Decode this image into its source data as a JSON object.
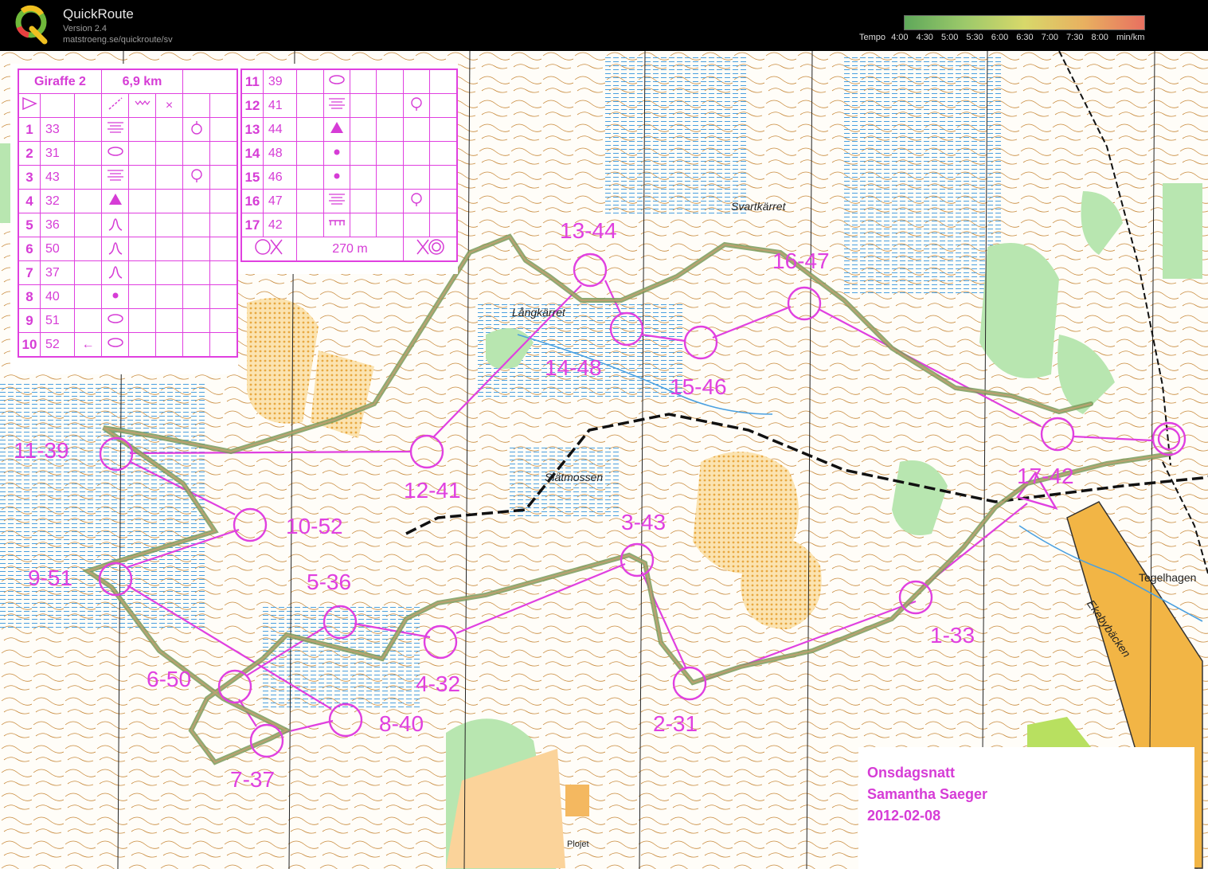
{
  "app": {
    "title": "QuickRoute",
    "version": "Version 2.4",
    "url": "matstroeng.se/quickroute/sv"
  },
  "tempo_legend": {
    "label": "Tempo",
    "ticks": [
      "4:00",
      "4:30",
      "5:00",
      "5:30",
      "6:00",
      "6:30",
      "7:00",
      "7:30",
      "8:00"
    ],
    "unit": "min/km",
    "colors": [
      "#5fa85a",
      "#9cc96a",
      "#d8d86a",
      "#e8b060",
      "#e87060"
    ]
  },
  "course": {
    "name": "Giraffe 2",
    "length": "6,9 km",
    "finish_distance": "270 m",
    "route_color": "#e040e0",
    "controls_left": [
      {
        "num": "1",
        "code": "33",
        "feature": "terrace",
        "extra": "ring"
      },
      {
        "num": "2",
        "code": "31",
        "feature": "depression",
        "extra": ""
      },
      {
        "num": "3",
        "code": "43",
        "feature": "terrace",
        "extra": "ring-lower"
      },
      {
        "num": "4",
        "code": "32",
        "feature": "triangle",
        "extra": ""
      },
      {
        "num": "5",
        "code": "36",
        "feature": "spur",
        "extra": ""
      },
      {
        "num": "6",
        "code": "50",
        "feature": "spur",
        "extra": ""
      },
      {
        "num": "7",
        "code": "37",
        "feature": "spur",
        "extra": ""
      },
      {
        "num": "8",
        "code": "40",
        "feature": "dot",
        "extra": ""
      },
      {
        "num": "9",
        "code": "51",
        "feature": "depression",
        "extra": ""
      },
      {
        "num": "10",
        "code": "52",
        "feature": "depression",
        "extra": "arrow"
      }
    ],
    "controls_right": [
      {
        "num": "11",
        "code": "39",
        "feature": "depression",
        "extra": ""
      },
      {
        "num": "12",
        "code": "41",
        "feature": "terrace",
        "extra": "ring-lower"
      },
      {
        "num": "13",
        "code": "44",
        "feature": "triangle",
        "extra": ""
      },
      {
        "num": "14",
        "code": "48",
        "feature": "dot",
        "extra": ""
      },
      {
        "num": "15",
        "code": "46",
        "feature": "dot",
        "extra": ""
      },
      {
        "num": "16",
        "code": "47",
        "feature": "terrace",
        "extra": "ring-lower"
      },
      {
        "num": "17",
        "code": "42",
        "feature": "wall",
        "extra": ""
      }
    ]
  },
  "map_labels": [
    {
      "id": "1-33",
      "text": "1-33"
    },
    {
      "id": "2-31",
      "text": "2-31"
    },
    {
      "id": "3-43",
      "text": "3-43"
    },
    {
      "id": "4-32",
      "text": "4-32"
    },
    {
      "id": "5-36",
      "text": "5-36"
    },
    {
      "id": "6-50",
      "text": "6-50"
    },
    {
      "id": "7-37",
      "text": "7-37"
    },
    {
      "id": "8-40",
      "text": "8-40"
    },
    {
      "id": "9-51",
      "text": "9-51"
    },
    {
      "id": "10-52",
      "text": "10-52"
    },
    {
      "id": "11-39",
      "text": "11-39"
    },
    {
      "id": "12-41",
      "text": "12-41"
    },
    {
      "id": "13-44",
      "text": "13-44"
    },
    {
      "id": "14-48",
      "text": "14-48"
    },
    {
      "id": "15-46",
      "text": "15-46"
    },
    {
      "id": "16-47",
      "text": "16-47"
    },
    {
      "id": "17-42",
      "text": "17-42"
    }
  ],
  "place_names": {
    "langkarret": "Långkärret",
    "svartkarret": "Svartkärret",
    "slatmossen": "Slätmossen",
    "tegelhagen": "Tegelhagen",
    "ekebybacken": "Ekebybäcken",
    "plojet": "Plojet"
  },
  "info": {
    "event": "Onsdagsnatt",
    "runner": "Samantha Saeger",
    "date": "2012-02-08"
  }
}
